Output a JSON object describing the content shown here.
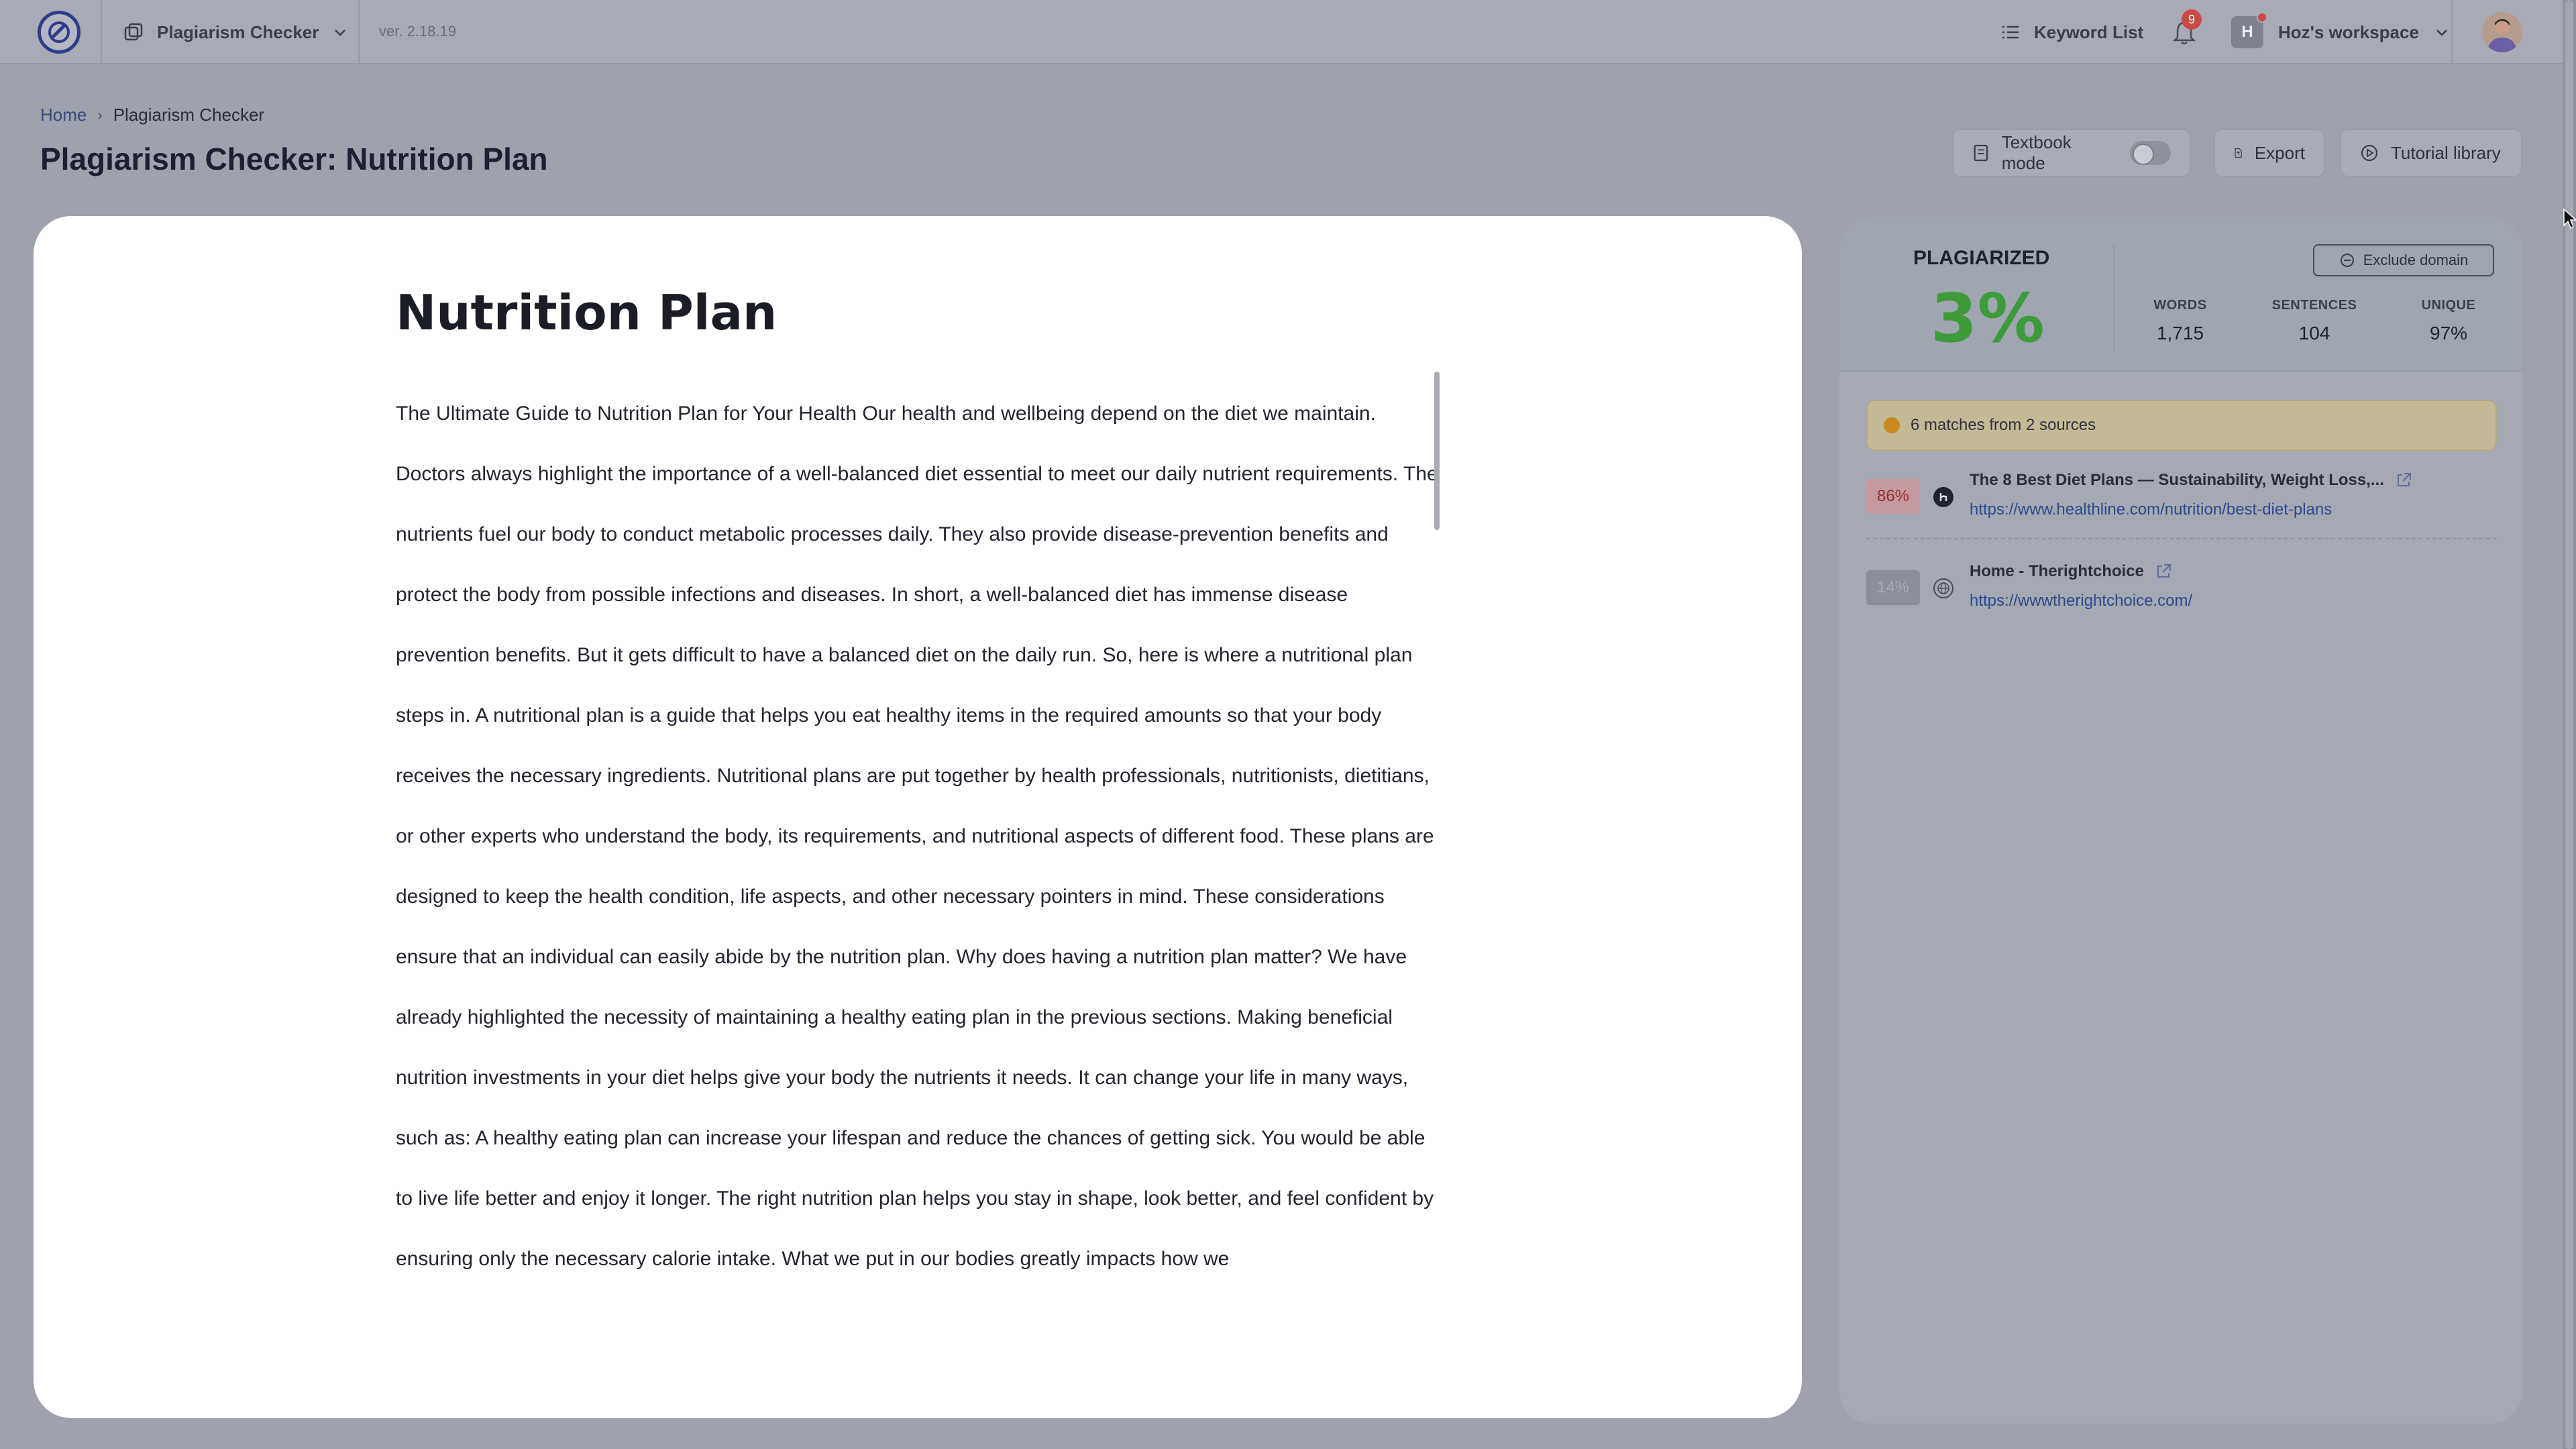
{
  "app": {
    "tool_switch_label": "Plagiarism Checker",
    "version": "ver. 2.18.19",
    "keyword_list_label": "Keyword List",
    "notifications_count": "9",
    "workspace_initial": "H",
    "workspace_name": "Hoz's workspace"
  },
  "breadcrumb": {
    "home": "Home",
    "current": "Plagiarism Checker"
  },
  "page": {
    "title_bold": "Plagiarism Checker:",
    "title_rest": "Nutrition Plan",
    "textbook_mode_label": "Textbook mode",
    "export_label": "Export",
    "tutorial_label": "Tutorial library"
  },
  "document": {
    "title": "Nutrition Plan",
    "body": "The Ultimate Guide to Nutrition Plan for Your Health Our health and wellbeing depend on the diet we maintain. Doctors always highlight the importance of a well-balanced diet essential to meet our daily nutrient requirements. The nutrients fuel our body to conduct metabolic processes daily. They also provide disease-prevention benefits and protect the body from possible infections and diseases. In short, a well-balanced diet has immense disease prevention benefits. But it gets difficult to have a balanced diet on the daily run. So, here is where a nutritional plan steps in. A nutritional plan is a guide that helps you eat healthy items in the required amounts so that your body receives the necessary ingredients. Nutritional plans are put together by health professionals, nutritionists, dietitians, or other experts who understand the body, its requirements, and nutritional aspects of different food. These plans are designed to keep the health condition, life aspects, and other necessary pointers in mind. These considerations ensure that an individual can easily abide by the nutrition plan. Why does having a nutrition plan matter? We have already highlighted the necessity of maintaining a healthy eating plan in the previous sections. Making beneficial nutrition investments in your diet helps give your body the nutrients it needs. It can change your life in many ways, such as: A healthy eating plan can increase your lifespan and reduce the chances of getting sick. You would be able to live life better and enjoy it longer. The right nutrition plan helps you stay in shape, look better, and feel confident by ensuring only the necessary calorie intake. What we put in our bodies greatly impacts how we"
  },
  "report": {
    "plagiarized_label": "PLAGIARIZED",
    "plagiarized_value": "3%",
    "exclude_domain_label": "Exclude domain",
    "stats": [
      {
        "label": "WORDS",
        "value": "1,715"
      },
      {
        "label": "SENTENCES",
        "value": "104"
      },
      {
        "label": "UNIQUE",
        "value": "97%"
      }
    ],
    "matches_summary": "6 matches from 2 sources",
    "sources": [
      {
        "percent": "86%",
        "title": "The 8 Best Diet Plans — Sustainability, Weight Loss,...",
        "url": "https://www.healthline.com/nutrition/best-diet-plans"
      },
      {
        "percent": "14%",
        "title": "Home - Therightchoice",
        "url": "https://wwwtherightchoice.com/"
      }
    ]
  },
  "colors": {
    "accent_green": "#3d9b3a",
    "badge_red": "#c94a43",
    "warning_amber": "#c98820"
  }
}
